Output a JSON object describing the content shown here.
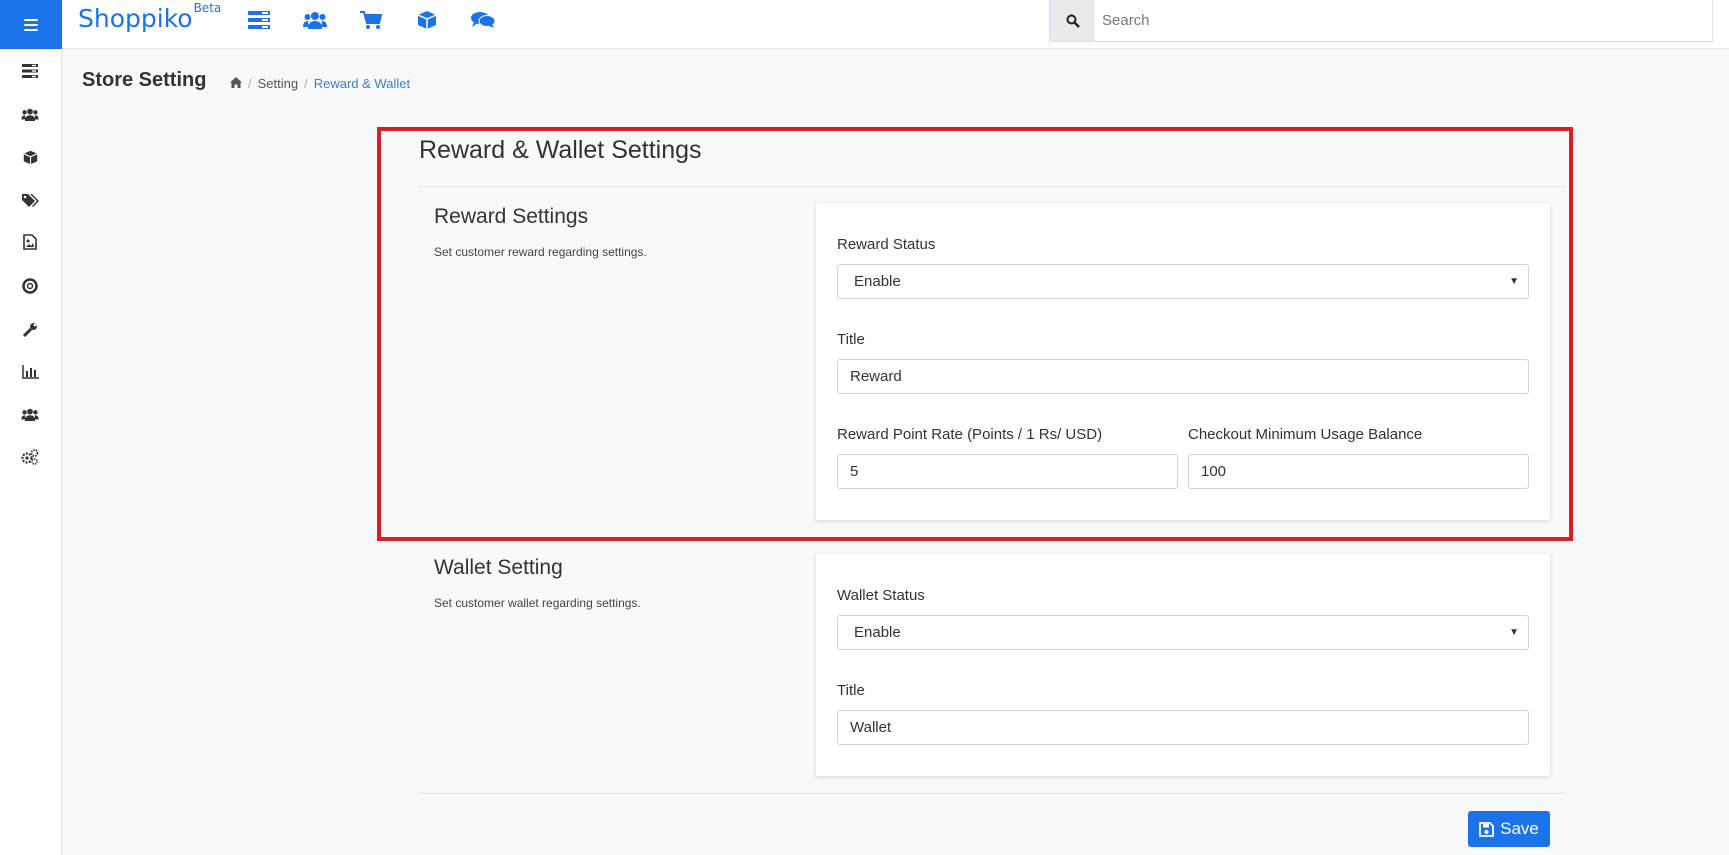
{
  "app": {
    "brand": "Shoppiko",
    "brand_tag": "Beta",
    "accent_color": "#1a73e8",
    "highlight_color": "#d81f26"
  },
  "topbar": {
    "menu_icon": "hamburger-icon",
    "icons": [
      "dashboard-icon",
      "users-icon",
      "cart-icon",
      "box-icon",
      "chat-icon"
    ],
    "search_placeholder": "Search"
  },
  "sidebar": {
    "icons": [
      "dashboard-icon",
      "users-icon",
      "box-icon",
      "tags-icon",
      "image-icon",
      "support-icon",
      "wrench-icon",
      "chart-icon",
      "users-icon",
      "settings-icon"
    ]
  },
  "page": {
    "title": "Store Setting",
    "breadcrumb": [
      "Setting",
      "Reward & Wallet"
    ]
  },
  "section": {
    "title": "Reward & Wallet Settings"
  },
  "reward": {
    "title": "Reward Settings",
    "description": "Set customer reward regarding settings.",
    "status_label": "Reward Status",
    "status_value": "Enable",
    "title_label": "Title",
    "title_value": "Reward",
    "rate_label": "Reward Point Rate (Points / 1 Rs/ USD)",
    "rate_value": "5",
    "min_label": "Checkout Minimum Usage Balance",
    "min_value": "100"
  },
  "wallet": {
    "title": "Wallet Setting",
    "description": "Set customer wallet regarding settings.",
    "status_label": "Wallet Status",
    "status_value": "Enable",
    "title_label": "Title",
    "title_value": "Wallet"
  },
  "actions": {
    "save_label": "Save"
  }
}
